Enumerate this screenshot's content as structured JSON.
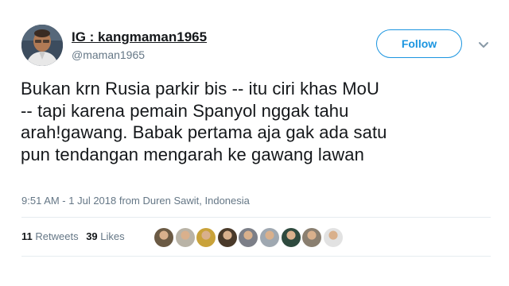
{
  "user": {
    "display_name": "IG : kangmaman1965",
    "handle": "@maman1965"
  },
  "follow_button": {
    "label": "Follow"
  },
  "tweet": {
    "lines": [
      "Bukan krn Rusia parkir bis -- itu ciri khas MoU",
      "-- tapi karena pemain Spanyol nggak tahu",
      "arah!gawang. Babak pertama aja gak ada satu",
      "pun tendangan mengarah ke gawang lawan"
    ],
    "timestamp": "9:51 AM - 1 Jul 2018 from Duren Sawit, Indonesia"
  },
  "stats": {
    "retweets_count": "11",
    "retweets_label": "Retweets",
    "likes_count": "39",
    "likes_label": "Likes"
  },
  "liker_avatars": [
    {
      "color": "#6b5a44"
    },
    {
      "color": "#b9b3a6"
    },
    {
      "color": "#c9a23a"
    },
    {
      "color": "#4a3a2a"
    },
    {
      "color": "#7c7f88"
    },
    {
      "color": "#9fa8b1"
    },
    {
      "color": "#2e4a3e"
    },
    {
      "color": "#8a7f70"
    },
    {
      "color": "#e2e2e2"
    }
  ],
  "colors": {
    "accent": "#1b95e0",
    "secondary_text": "#657786",
    "primary_text": "#14171a",
    "divider": "#e6ecf0"
  }
}
